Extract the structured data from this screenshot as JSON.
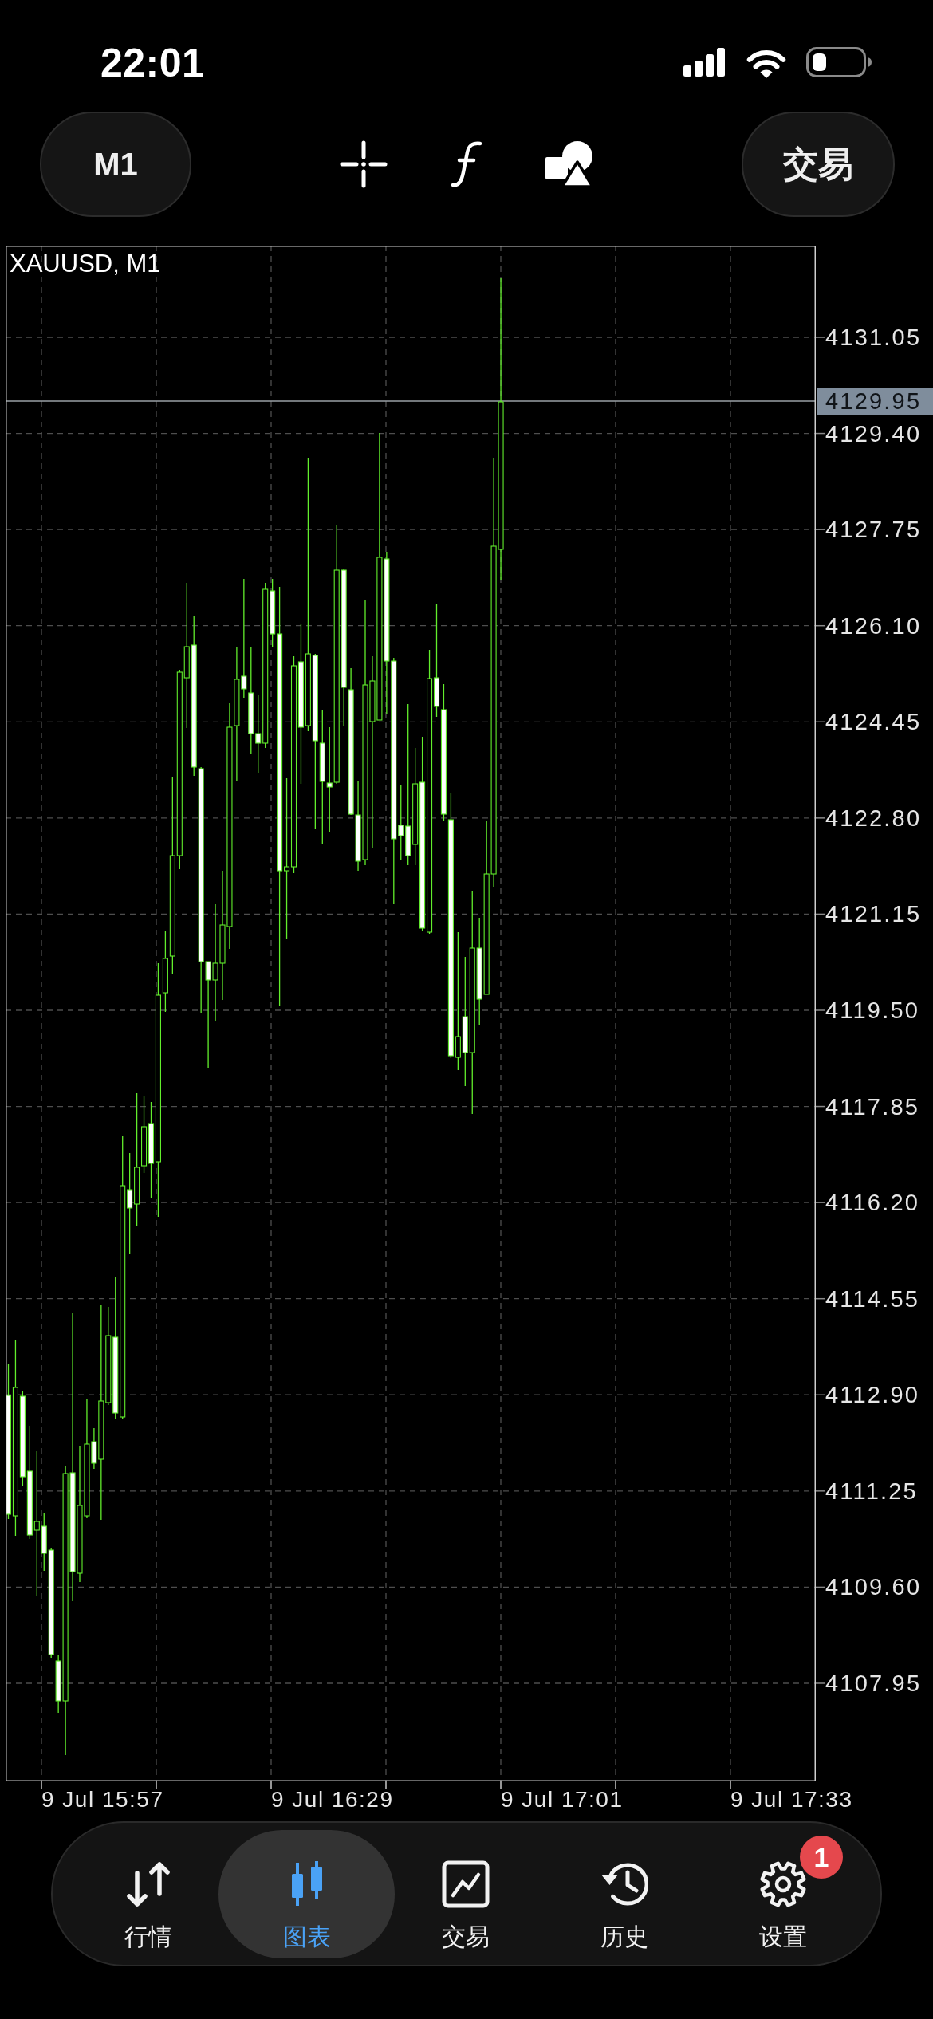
{
  "status_bar": {
    "time": "22:01"
  },
  "toolbar": {
    "timeframe_button": "M1",
    "trade_button": "交易"
  },
  "chart": {
    "title": "XAUUSD, M1",
    "current_price": "4129.95",
    "price_axis": [
      "4131.05",
      "4129.40",
      "4127.75",
      "4126.10",
      "4124.45",
      "4122.80",
      "4121.15",
      "4119.50",
      "4117.85",
      "4116.20",
      "4114.55",
      "4112.90",
      "4111.25",
      "4109.60",
      "4107.95"
    ],
    "time_axis": [
      "9 Jul 15:57",
      "9 Jul 16:29",
      "9 Jul 17:01",
      "9 Jul 17:33"
    ]
  },
  "tab_bar": {
    "tabs": [
      {
        "label": "行情",
        "kind": "quotes",
        "selected": false
      },
      {
        "label": "图表",
        "kind": "chart",
        "selected": true
      },
      {
        "label": "交易",
        "kind": "trade",
        "selected": false
      },
      {
        "label": "历史",
        "kind": "history",
        "selected": false
      },
      {
        "label": "设置",
        "kind": "settings",
        "selected": false,
        "badge": "1"
      }
    ]
  }
}
